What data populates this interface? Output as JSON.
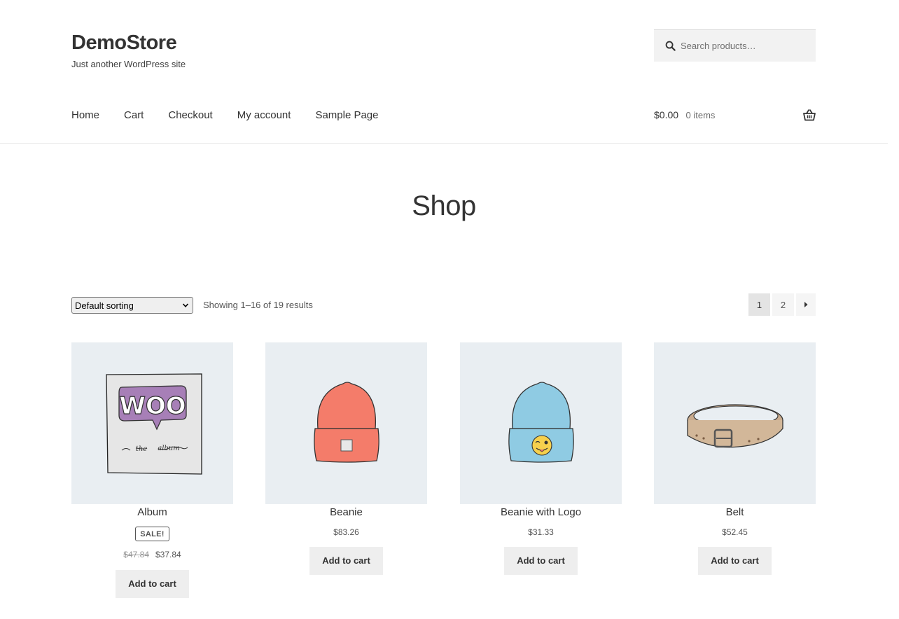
{
  "header": {
    "site_title": "DemoStore",
    "tagline": "Just another WordPress site",
    "search_placeholder": "Search products…"
  },
  "nav": {
    "items": [
      "Home",
      "Cart",
      "Checkout",
      "My account",
      "Sample Page"
    ]
  },
  "mini_cart": {
    "amount": "$0.00",
    "count": "0 items"
  },
  "page": {
    "title": "Shop",
    "sorting": "Default sorting",
    "result_count": "Showing 1–16 of 19 results",
    "pages": [
      "1",
      "2"
    ]
  },
  "products": [
    {
      "name": "Album",
      "badge": "SALE!",
      "old_price": "$47.84",
      "price": "$37.84",
      "button": "Add to cart"
    },
    {
      "name": "Beanie",
      "price": "$83.26",
      "button": "Add to cart"
    },
    {
      "name": "Beanie with Logo",
      "price": "$31.33",
      "button": "Add to cart"
    },
    {
      "name": "Belt",
      "price": "$52.45",
      "button": "Add to cart"
    }
  ],
  "colors": {
    "thumb_bg": "#e9eef2",
    "button_bg": "#eeeeee",
    "text": "#333333"
  },
  "icons": [
    "search-icon",
    "basket-icon",
    "chevron-down-icon",
    "arrow-right-icon"
  ]
}
